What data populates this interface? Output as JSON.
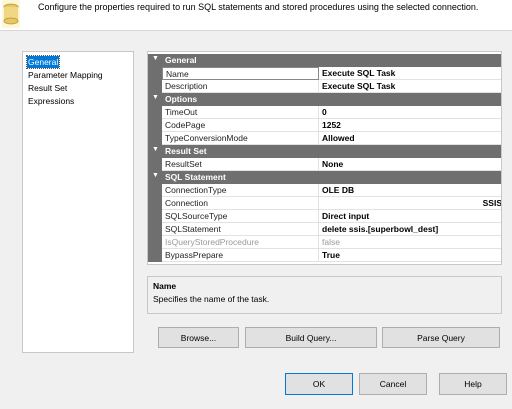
{
  "header": {
    "description": "Configure the properties required to run SQL statements and stored procedures using the selected connection."
  },
  "nav": {
    "items": [
      {
        "label": "General",
        "selected": true
      },
      {
        "label": "Parameter Mapping"
      },
      {
        "label": "Result Set"
      },
      {
        "label": "Expressions"
      }
    ]
  },
  "grid": {
    "general": {
      "label": "General",
      "name": {
        "name": "Name",
        "value": "Execute SQL Task"
      },
      "description": {
        "name": "Description",
        "value": "Execute SQL Task"
      }
    },
    "options": {
      "label": "Options",
      "timeout": {
        "name": "TimeOut",
        "value": "0"
      },
      "codepage": {
        "name": "CodePage",
        "value": "1252"
      },
      "typeconv": {
        "name": "TypeConversionMode",
        "value": "Allowed"
      }
    },
    "resultset": {
      "label": "Result Set",
      "resultset": {
        "name": "ResultSet",
        "value": "None"
      }
    },
    "sql": {
      "label": "SQL Statement",
      "conntype": {
        "name": "ConnectionType",
        "value": "OLE DB"
      },
      "connection": {
        "name": "Connection",
        "value": "SSIS"
      },
      "source": {
        "name": "SQLSourceType",
        "value": "Direct input"
      },
      "statement": {
        "name": "SQLStatement",
        "value": "delete  ssis.[superbowl_dest]"
      },
      "isproc": {
        "name": "IsQueryStoredProcedure",
        "value": "false"
      },
      "bypass": {
        "name": "BypassPrepare",
        "value": "True"
      }
    }
  },
  "desc": {
    "title": "Name",
    "text": "Specifies the name of the task."
  },
  "buttons": {
    "browse": "Browse...",
    "build": "Build Query...",
    "parse": "Parse Query",
    "ok": "OK",
    "cancel": "Cancel",
    "help": "Help"
  },
  "colors": {
    "category_bg": "#6f6f6f",
    "selected_bg": "#0078d7",
    "primary_border": "#0078d7"
  }
}
